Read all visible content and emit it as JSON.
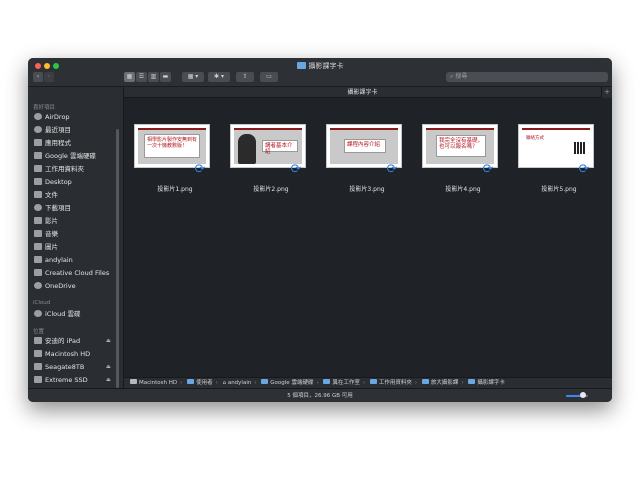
{
  "window": {
    "title": "攝影課字卡"
  },
  "toolbar": {
    "back_icon": "chevron-left-icon",
    "forward_icon": "chevron-right-icon",
    "view_icons": [
      "icon-view-icon",
      "list-view-icon",
      "column-view-icon",
      "gallery-view-icon"
    ],
    "group_icon": "group-by-icon",
    "action_icon": "gear-icon",
    "share_icon": "share-icon",
    "tag_icon": "tag-icon",
    "search_placeholder": "搜尋"
  },
  "path_tab": {
    "label": "攝影課字卡"
  },
  "sidebar": {
    "favorites_header": "喜好項目",
    "favorites": [
      {
        "label": "AirDrop",
        "icon": "airdrop-icon"
      },
      {
        "label": "最近項目",
        "icon": "clock-icon"
      },
      {
        "label": "應用程式",
        "icon": "applications-icon"
      },
      {
        "label": "Google 雲端硬碟",
        "icon": "google-drive-icon"
      },
      {
        "label": "工作用資料夾",
        "icon": "folder-icon"
      },
      {
        "label": "Desktop",
        "icon": "desktop-icon"
      },
      {
        "label": "文件",
        "icon": "document-icon"
      },
      {
        "label": "下載項目",
        "icon": "download-icon"
      },
      {
        "label": "影片",
        "icon": "film-icon"
      },
      {
        "label": "音樂",
        "icon": "music-icon"
      },
      {
        "label": "圖片",
        "icon": "camera-icon"
      },
      {
        "label": "andylain",
        "icon": "home-icon"
      },
      {
        "label": "Creative Cloud Files",
        "icon": "folder-icon"
      },
      {
        "label": "OneDrive",
        "icon": "onedrive-icon"
      }
    ],
    "icloud_header": "iCloud",
    "icloud": [
      {
        "label": "iCloud 雲碟",
        "icon": "cloud-icon"
      }
    ],
    "locations_header": "位置",
    "locations": [
      {
        "label": "安迪的 iPad",
        "icon": "ipad-icon",
        "eject": true
      },
      {
        "label": "Macintosh HD",
        "icon": "drive-icon",
        "eject": false
      },
      {
        "label": "Seagate8TB",
        "icon": "drive-icon",
        "eject": true
      },
      {
        "label": "Extreme SSD",
        "icon": "drive-icon",
        "eject": true
      }
    ]
  },
  "files": [
    {
      "name": "投影片1.png",
      "slide_text": "相學影片製作安無到有一次十機教數版！"
    },
    {
      "name": "投影片2.png",
      "slide_text": "講者基本介紹"
    },
    {
      "name": "投影片3.png",
      "slide_text": "課程內容介紹"
    },
    {
      "name": "投影片4.png",
      "slide_text": "我完全沒有基礎，也可以報名嗎？"
    },
    {
      "name": "投影片5.png",
      "slide_text": "聯絡方式"
    }
  ],
  "pathbar": {
    "crumbs": [
      "Macintosh HD",
      "使用者",
      "andylain",
      "Google 雲端硬碟",
      "異在工作室",
      "工作用資料夾",
      "旅大攝影課",
      "攝影課字卡"
    ]
  },
  "status": {
    "text": "5 個項目，26.96 GB 可用",
    "zoom_level": 0.75
  },
  "colors": {
    "accent": "#3b87f5",
    "sync": "#2e7de0",
    "slide_red": "#b0151b"
  }
}
